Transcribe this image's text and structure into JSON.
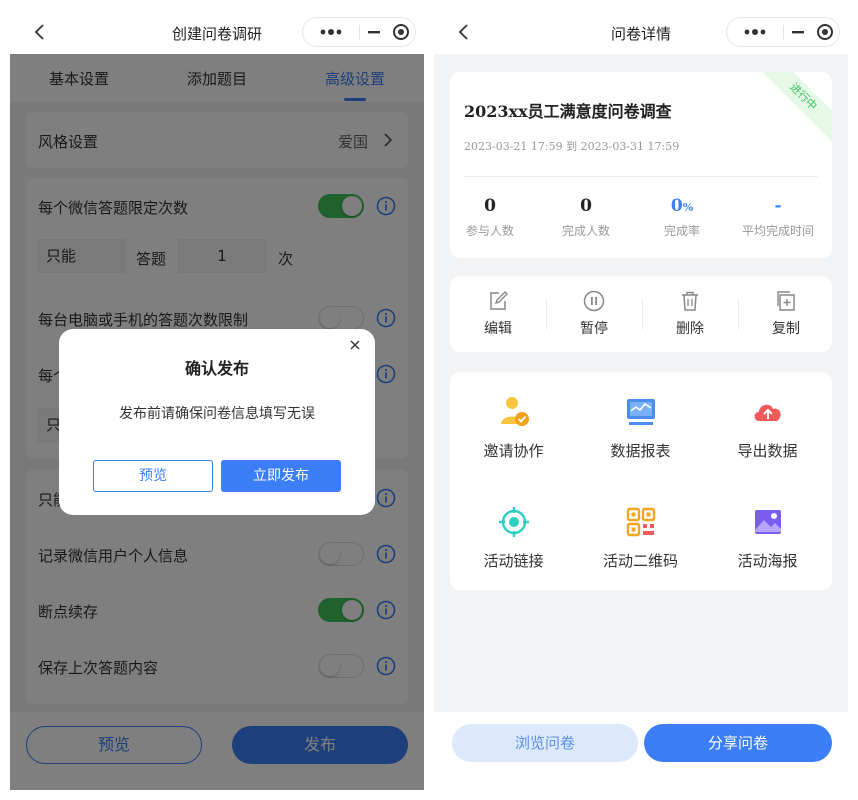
{
  "left": {
    "nav_title": "创建问卷调研",
    "tabs": [
      {
        "label": "基本设置",
        "active": false
      },
      {
        "label": "添加题目",
        "active": false
      },
      {
        "label": "高级设置",
        "active": true
      }
    ],
    "style_row": {
      "label": "风格设置",
      "value": "爱国"
    },
    "limit_per_wechat": {
      "label": "每个微信答题限定次数",
      "enabled": true,
      "prefix": "只能",
      "middle": "答题",
      "count": "1",
      "suffix": "次"
    },
    "limit_per_device": {
      "label": "每台电脑或手机的答题次数限制",
      "enabled": false
    },
    "partial_row_1": {
      "label": "每个",
      "prefix": "只"
    },
    "partial_row_2": {
      "label": "只能"
    },
    "record_user_info": {
      "label": "记录微信用户个人信息",
      "enabled": false
    },
    "resume": {
      "label": "断点续存",
      "enabled": true
    },
    "save_last": {
      "label": "保存上次答题内容",
      "enabled": false
    },
    "bottom": {
      "preview_label": "预览",
      "publish_label": "发布"
    },
    "modal": {
      "title": "确认发布",
      "message": "发布前请确保问卷信息填写无误",
      "preview_label": "预览",
      "publish_label": "立即发布"
    }
  },
  "right": {
    "nav_title": "问卷详情",
    "survey": {
      "title": "2023xx员工满意度问卷调查",
      "time_range": "2023-03-21 17:59 到 2023-03-31 17:59",
      "status_ribbon": "进行中",
      "stats": [
        {
          "value": "0",
          "label": "参与人数"
        },
        {
          "value": "0",
          "label": "完成人数"
        },
        {
          "value": "0",
          "unit": "%",
          "label": "完成率"
        },
        {
          "value": "-",
          "label": "平均完成时间"
        }
      ]
    },
    "actions": [
      {
        "label": "编辑",
        "icon": "edit-icon"
      },
      {
        "label": "暂停",
        "icon": "pause-icon"
      },
      {
        "label": "删除",
        "icon": "trash-icon"
      },
      {
        "label": "复制",
        "icon": "copy-icon"
      }
    ],
    "features": [
      {
        "label": "邀请协作",
        "icon": "invite-users-icon"
      },
      {
        "label": "数据报表",
        "icon": "report-chart-icon"
      },
      {
        "label": "导出数据",
        "icon": "cloud-upload-icon"
      },
      {
        "label": "活动链接",
        "icon": "link-target-icon"
      },
      {
        "label": "活动二维码",
        "icon": "qr-code-icon"
      },
      {
        "label": "活动海报",
        "icon": "poster-image-icon"
      }
    ],
    "bottom": {
      "browse_label": "浏览问卷",
      "share_label": "分享问卷"
    }
  },
  "colors": {
    "accent": "#3b7ef6",
    "toggle_on": "#3ec45a",
    "background": "#f2f3f5"
  }
}
